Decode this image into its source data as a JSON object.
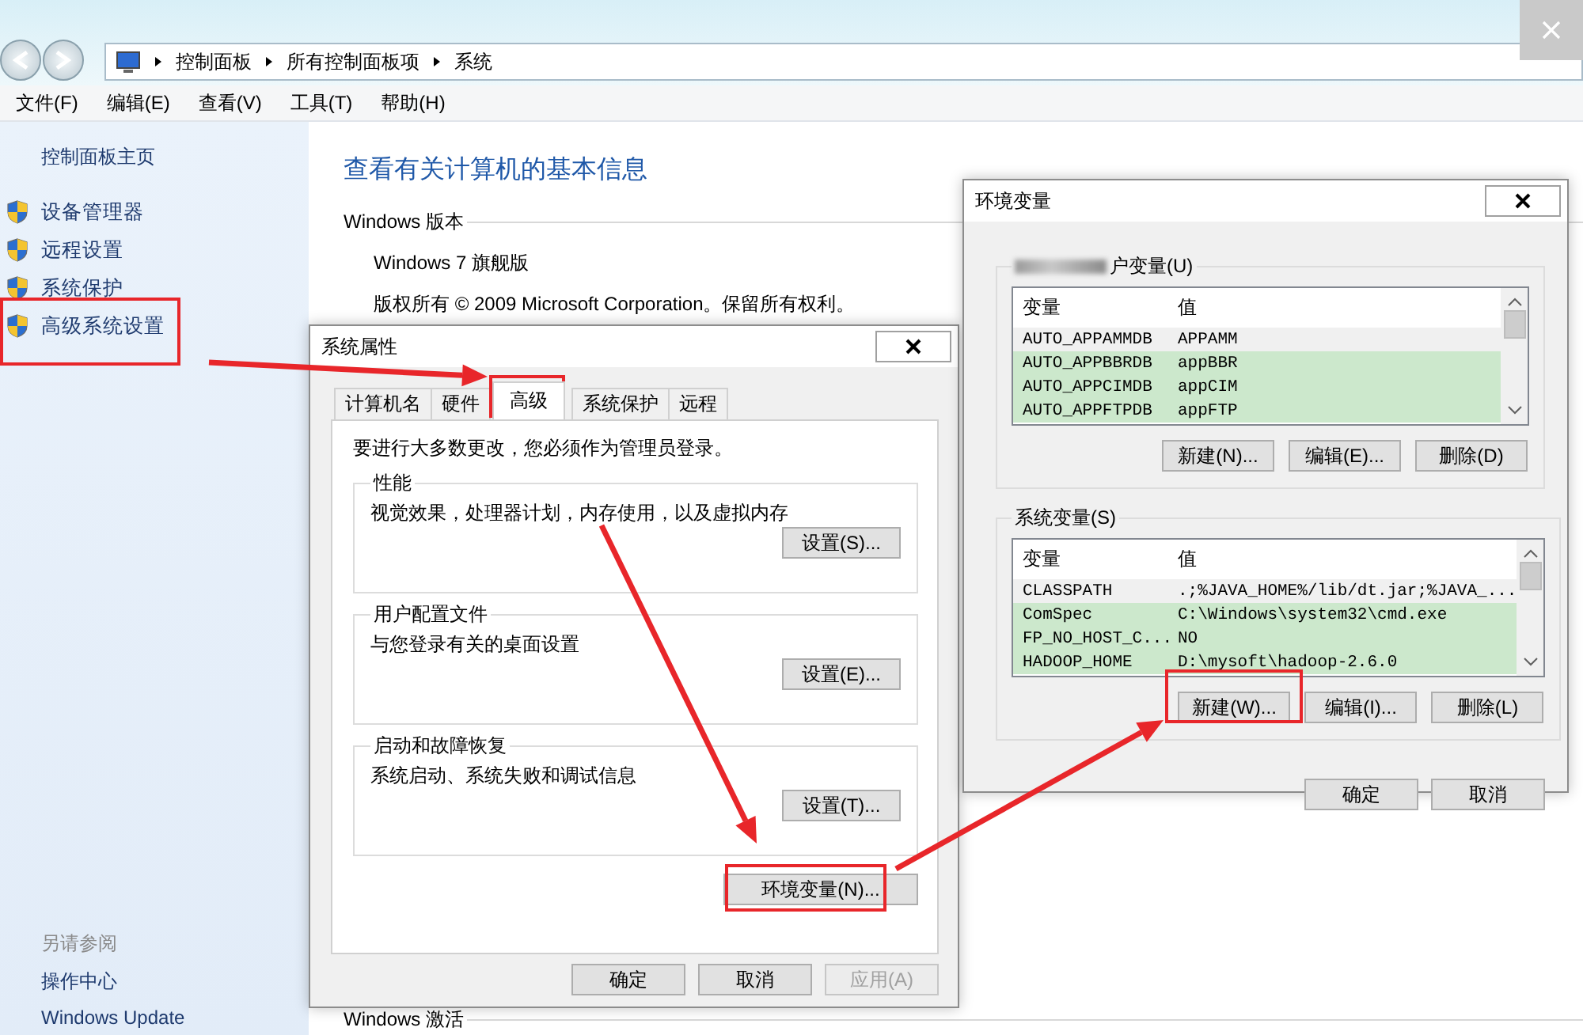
{
  "address_bar": {
    "path": [
      "控制面板",
      "所有控制面板项",
      "系统"
    ]
  },
  "menu": [
    "文件(F)",
    "编辑(E)",
    "查看(V)",
    "工具(T)",
    "帮助(H)"
  ],
  "sidebar": {
    "home": "控制面板主页",
    "items": [
      "设备管理器",
      "远程设置",
      "系统保护",
      "高级系统设置"
    ],
    "see_also_title": "另请参阅",
    "see_also": [
      "操作中心",
      "Windows Update"
    ]
  },
  "content": {
    "title": "查看有关计算机的基本信息",
    "section_heading": "Windows 版本",
    "lines": [
      "Windows 7 旗舰版",
      "版权所有 © 2009 Microsoft Corporation。保留所有权利。"
    ],
    "activation_heading": "Windows 激活"
  },
  "system_properties": {
    "title": "系统属性",
    "tabs": [
      {
        "label": "计算机名",
        "selected": false
      },
      {
        "label": "硬件",
        "selected": false
      },
      {
        "label": "高级",
        "selected": true
      },
      {
        "label": "系统保护",
        "selected": false
      },
      {
        "label": "远程",
        "selected": false
      }
    ],
    "notice": "要进行大多数更改，您必须作为管理员登录。",
    "groups": [
      {
        "title": "性能",
        "description": "视觉效果，处理器计划，内存使用，以及虚拟内存",
        "button": "设置(S)..."
      },
      {
        "title": "用户配置文件",
        "description": "与您登录有关的桌面设置",
        "button": "设置(E)..."
      },
      {
        "title": "启动和故障恢复",
        "description": "系统启动、系统失败和调试信息",
        "button": "设置(T)..."
      }
    ],
    "env_button": "环境变量(N)...",
    "buttons": [
      {
        "label": "确定",
        "disabled": false
      },
      {
        "label": "取消",
        "disabled": false
      },
      {
        "label": "应用(A)",
        "disabled": true
      }
    ]
  },
  "environment_variables": {
    "title": "环境变量",
    "user_vars": {
      "label": "户变量(U)",
      "columns": [
        "变量",
        "值"
      ],
      "rows": [
        {
          "name": "AUTO_APPAMMDB",
          "value": "APPAMM",
          "highlighted": false
        },
        {
          "name": "AUTO_APPBBRDB",
          "value": "appBBR",
          "highlighted": true
        },
        {
          "name": "AUTO_APPCIMDB",
          "value": "appCIM",
          "highlighted": true
        },
        {
          "name": "AUTO_APPFTPDB",
          "value": "appFTP",
          "highlighted": true
        }
      ],
      "buttons": [
        "新建(N)...",
        "编辑(E)...",
        "删除(D)"
      ]
    },
    "system_vars": {
      "label": "系统变量(S)",
      "columns": [
        "变量",
        "值"
      ],
      "rows": [
        {
          "name": "CLASSPATH",
          "value": ".;%JAVA_HOME%/lib/dt.jar;%JAVA_...",
          "highlighted": false
        },
        {
          "name": "ComSpec",
          "value": "C:\\Windows\\system32\\cmd.exe",
          "highlighted": true
        },
        {
          "name": "FP_NO_HOST_C...",
          "value": "NO",
          "highlighted": true
        },
        {
          "name": "HADOOP_HOME",
          "value": "D:\\mysoft\\hadoop-2.6.0",
          "highlighted": true
        }
      ],
      "buttons": [
        "新建(W)...",
        "编辑(I)...",
        "删除(L)"
      ]
    },
    "buttons": [
      "确定",
      "取消"
    ]
  }
}
